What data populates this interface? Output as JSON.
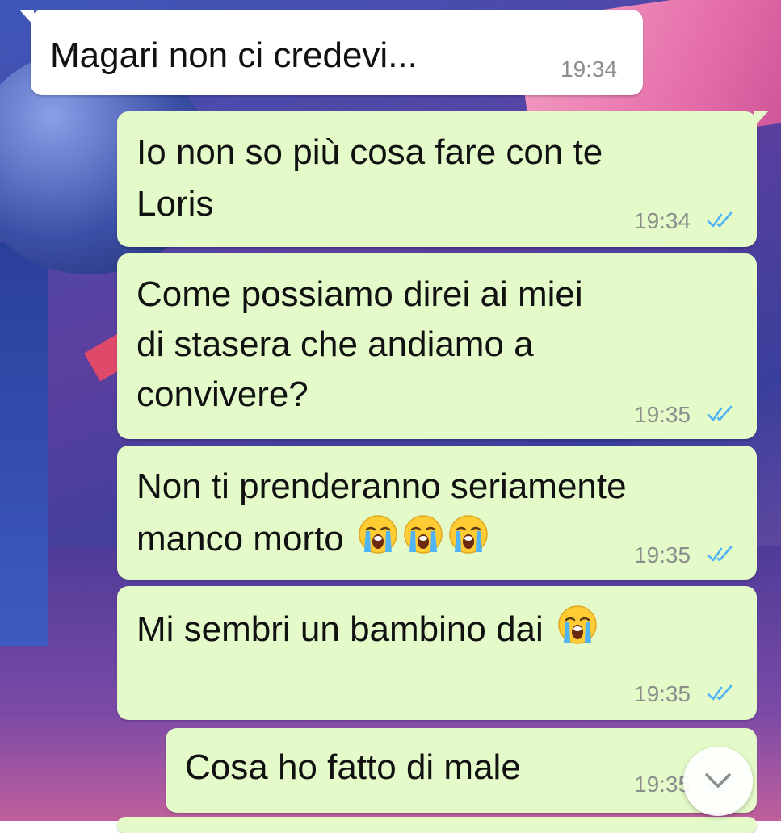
{
  "messages": [
    {
      "direction": "incoming",
      "text": "Magari non ci credevi...",
      "time": "19:34"
    },
    {
      "direction": "outgoing",
      "line1": "Io non so più cosa fare con te",
      "line2": "Loris",
      "time": "19:34",
      "status": "read"
    },
    {
      "direction": "outgoing",
      "line1": "Come possiamo direi ai miei",
      "line2": "di stasera che andiamo a",
      "line3": "convivere?",
      "time": "19:35",
      "status": "read"
    },
    {
      "direction": "outgoing",
      "line1": "Non ti prenderanno seriamente",
      "line2": "manco morto",
      "emoji": [
        "loudly-crying-face",
        "loudly-crying-face",
        "loudly-crying-face"
      ],
      "time": "19:35",
      "status": "read"
    },
    {
      "direction": "outgoing",
      "text": "Mi sembri un bambino dai",
      "emoji": [
        "loudly-crying-face"
      ],
      "time": "19:35",
      "status": "read"
    },
    {
      "direction": "outgoing",
      "text": "Cosa ho fatto di male",
      "time": "19:35",
      "status": "read"
    }
  ],
  "colors": {
    "incoming_bubble": "#ffffff",
    "outgoing_bubble": "#e4fac9",
    "read_ticks": "#4fb3f6",
    "timestamp": "#8a8f8c"
  },
  "icons": {
    "scroll_down": "chevron-down-icon",
    "read_receipt": "double-check-icon"
  }
}
